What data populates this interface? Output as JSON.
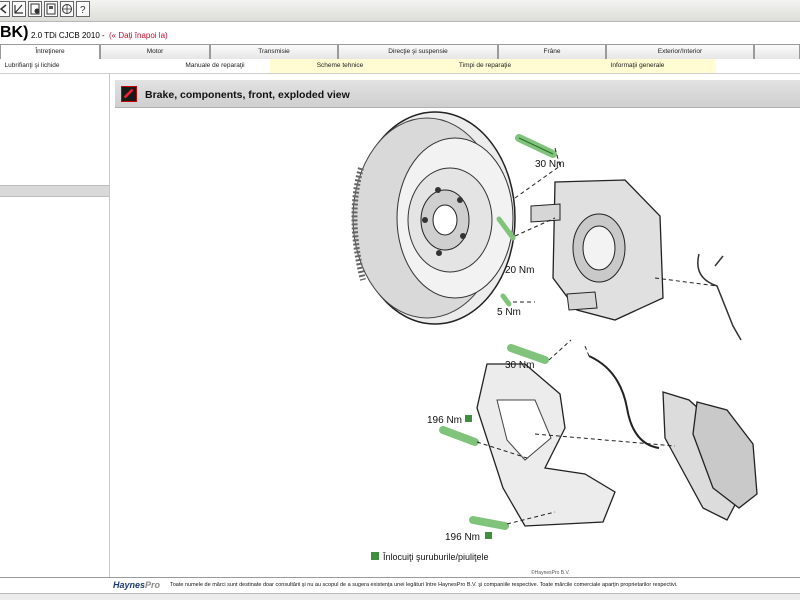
{
  "toolbar": {
    "icons": [
      "back-icon",
      "edit-icon",
      "settings-icon",
      "print-icon",
      "globe-icon",
      "help-icon"
    ]
  },
  "header": {
    "vehicle_code": "BK)",
    "engine": "2.0 TDi CJCB 2010 -",
    "back_link": "(« Daţi înapoi la)"
  },
  "tabs": [
    {
      "label": "Întreţinere"
    },
    {
      "label": "Motor"
    },
    {
      "label": "Transmisie"
    },
    {
      "label": "Direcţie şi suspensie"
    },
    {
      "label": "Frâne"
    },
    {
      "label": "Exterior/Interior"
    }
  ],
  "subtabs": [
    {
      "label": "Lubrifianţi şi lichide"
    },
    {
      "label": "Manuale de reparaţii"
    },
    {
      "label": "Scheme tehnice"
    },
    {
      "label": "Timpi de reparaţie"
    },
    {
      "label": "Informaţii generale"
    }
  ],
  "content": {
    "title": "Brake, components, front, exploded view",
    "torque_labels": {
      "t1": "30 Nm",
      "t2": "20 Nm",
      "t3": "5 Nm",
      "t4": "30 Nm",
      "t5": "196 Nm",
      "t6": "196 Nm"
    },
    "legend": "Înlocuiţi şuruburile/piuliţele",
    "copyright": "©HaynesPro B.V."
  },
  "footer": {
    "logo_main": "Haynes",
    "logo_suffix": "Pro",
    "notice": "Toate numele de mărci sunt destinate doar consultării şi nu au scopul de a sugera existenţa unei legături între HaynesPro B.V. şi companiile respective. Toate mărcile comerciale aparţin proprietarilor respectivi."
  },
  "colors": {
    "accent_red": "#c8102e",
    "replace_marker": "#3f8f3f",
    "bolt_green": "#7fc47a"
  }
}
